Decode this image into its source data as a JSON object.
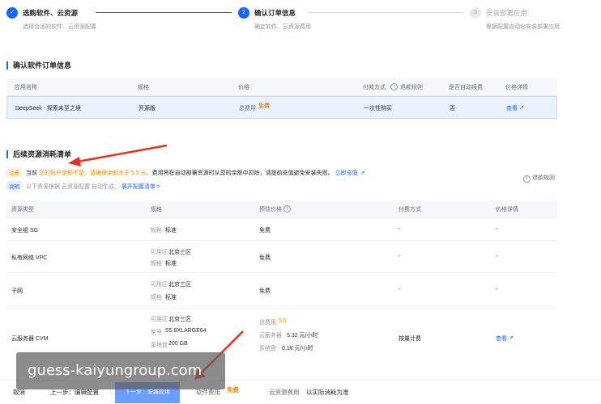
{
  "steps": [
    {
      "number": "✓",
      "title": "选购软件、云资源",
      "desc": "选择合适的软件、云资源配置",
      "state": "done"
    },
    {
      "number": "2",
      "title": "确认订单信息",
      "desc": "确定软件、云资源费用",
      "state": "active"
    },
    {
      "number": "3",
      "title": "安装部署应用",
      "desc": "根据配置自动化安装部署应用",
      "state": "pending"
    }
  ],
  "order_section": {
    "title": "确认软件订单信息",
    "columns": [
      "应用名称",
      "规格",
      "价格",
      "付款方式",
      "退款规则",
      "是否自动续费",
      "价格详情"
    ],
    "row": {
      "name": "DeepSeek - 探索未至之境",
      "spec": "开源版",
      "price_label": "总费用",
      "price_value": "免费",
      "payment": "一次性购买",
      "auto_renew": "否",
      "detail": "查看"
    }
  },
  "resource_section": {
    "title": "后续资源消耗清单",
    "warning_tag": "注意",
    "warning_prefix": "当前",
    "warning_highlight": "您的账户余额不足，请确保余额大于 5.5 元。",
    "warning_rest": "费用将在自动部署资源时从您的余额中扣除，请提前充值避免安装失败。",
    "warning_link": "立即充值",
    "info_tag": "说明",
    "info_text": "以下资源根据 云资源配置 自动生成。",
    "info_link": "展开配置清单 >",
    "refund_rule": "退款规则",
    "columns": [
      "资源类型",
      "规格",
      "预估价格",
      "付费方式",
      "价格详情"
    ],
    "rows": [
      {
        "type": "安全组 SG",
        "spec_lines": [
          {
            "k": "规格",
            "v": "标准"
          }
        ],
        "price_lines": [
          "免费"
        ],
        "payment": "-",
        "detail": "-"
      },
      {
        "type": "私有网络 VPC",
        "spec_lines": [
          {
            "k": "可用区",
            "v": "北京三区"
          },
          {
            "k": "规格",
            "v": "标准"
          }
        ],
        "price_lines": [
          "免费"
        ],
        "payment": "-",
        "detail": "-"
      },
      {
        "type": "子网",
        "spec_lines": [
          {
            "k": "可用区",
            "v": "北京三区"
          },
          {
            "k": "规格",
            "v": "标准"
          }
        ],
        "price_lines": [
          "免费"
        ],
        "payment": "-",
        "detail": "-"
      },
      {
        "type": "云服务器 CVM",
        "spec_lines": [
          {
            "k": "可用区",
            "v": "北京三区"
          },
          {
            "k": "型号",
            "v": "S5.8XLARGE64"
          },
          {
            "k": "系统盘",
            "v": "200 GB"
          }
        ],
        "price_total_label": "总费用",
        "price_total_value": "5.5",
        "price_items": [
          {
            "k": "云服务器",
            "v": "5.32 元/小时"
          },
          {
            "k": "系统盘",
            "v": "0.18 元/小时"
          }
        ],
        "payment": "按量计费",
        "detail": "查看"
      }
    ]
  },
  "bottom_bar": {
    "cancel": "取消",
    "prev": "上一步：编辑配置",
    "next": "下一步：安装应用",
    "software_fee_label": "软件费用",
    "software_fee_value": "免费",
    "cloud_fee_label": "云资源费用",
    "cloud_fee_value": "以实际消耗为准"
  },
  "watermark": "guess-kaiyungroup.com",
  "colors": {
    "primary": "#1664ff",
    "warning": "#f08a00",
    "arrow": "#e8321f"
  }
}
